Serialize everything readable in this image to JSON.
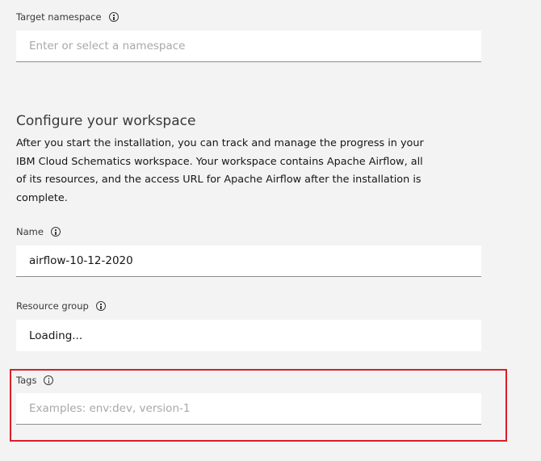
{
  "target_namespace": {
    "label": "Target namespace",
    "placeholder": "Enter or select a namespace"
  },
  "workspace": {
    "heading": "Configure your workspace",
    "description": "After you start the installation, you can track and manage the progress in your IBM Cloud Schematics workspace. Your workspace contains Apache Airflow, all of its resources, and the access URL for Apache Airflow after the installation is complete."
  },
  "name_field": {
    "label": "Name",
    "value": "airflow-10-12-2020"
  },
  "resource_group": {
    "label": "Resource group",
    "value": "Loading..."
  },
  "tags_field": {
    "label": "Tags",
    "placeholder": "Examples: env:dev, version-1"
  },
  "colors": {
    "background": "#f3f3f3",
    "field_background": "#ffffff",
    "highlight": "#da1e28"
  },
  "icons": [
    "info-icon"
  ]
}
